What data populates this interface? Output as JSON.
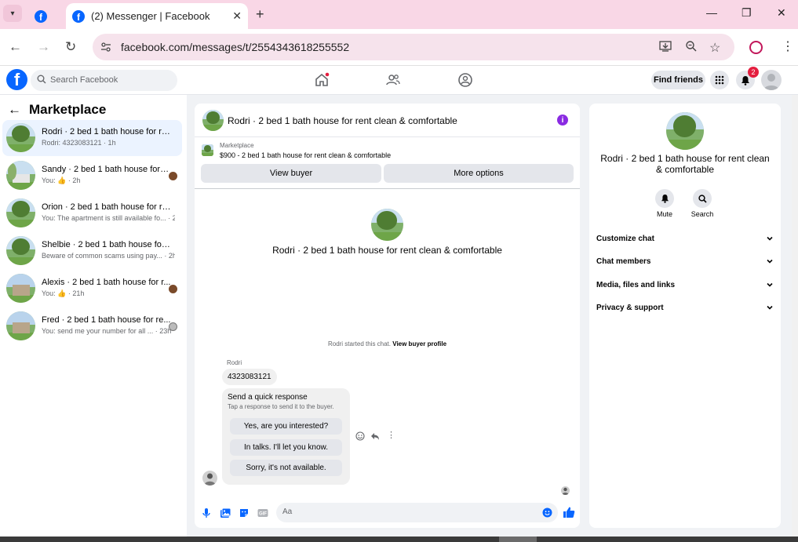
{
  "browser": {
    "tab_title": "(2) Messenger | Facebook",
    "url": "facebook.com/messages/t/2554343618255552"
  },
  "fb": {
    "logo": "f",
    "search_placeholder": "Search Facebook",
    "find_friends": "Find friends",
    "notification_count": "2"
  },
  "sidebar": {
    "title": "Marketplace",
    "chats": [
      {
        "name": "Rodri · 2 bed 1 bath house for rent...",
        "preview": "Rodri: 4323083121 · 1h",
        "selected": true
      },
      {
        "name": "Sandy · 2 bed 1 bath house for r...",
        "preview": "You: 👍 · 2h"
      },
      {
        "name": "Orion · 2 bed 1 bath house for rent...",
        "preview": "You: The apartment is still available fo... · 2h"
      },
      {
        "name": "Shelbie · 2 bed 1 bath house for re...",
        "preview": "Beware of common scams using pay... · 2h"
      },
      {
        "name": "Alexis · 2 bed 1 bath house for r...",
        "preview": "You: 👍 · 21h"
      },
      {
        "name": "Fred · 2 bed 1 bath house for re...",
        "preview": "You: send me your number for all ... · 23h"
      }
    ]
  },
  "conversation": {
    "title": "Rodri · 2 bed 1 bath house for rent clean & comfortable",
    "listing_category": "Marketplace",
    "listing_price": "$900 - 2 bed 1 bath house for rent clean & comfortable",
    "view_buyer": "View buyer",
    "more_options": "More options",
    "intro_title": "Rodri · 2 bed 1 bath house for rent clean & comfortable",
    "started_text": "Rodri started this chat.",
    "view_buyer_profile": "View buyer profile",
    "sender_name": "Rodri",
    "message": "4323083121",
    "quick_title": "Send a quick response",
    "quick_subtitle": "Tap a response to send it to the buyer.",
    "quick_responses": [
      "Yes, are you interested?",
      "In talks. I'll let you know.",
      "Sorry, it's not available."
    ],
    "input_placeholder": "Aa"
  },
  "details": {
    "title": "Rodri · 2 bed 1 bath house for rent clean & comfortable",
    "mute": "Mute",
    "search": "Search",
    "sections": [
      "Customize chat",
      "Chat members",
      "Media, files and links",
      "Privacy & support"
    ]
  },
  "colors": {
    "fb_blue": "#0866ff",
    "tabstrip": "#f9d7e6",
    "selected_chat": "#ebf3ff"
  }
}
